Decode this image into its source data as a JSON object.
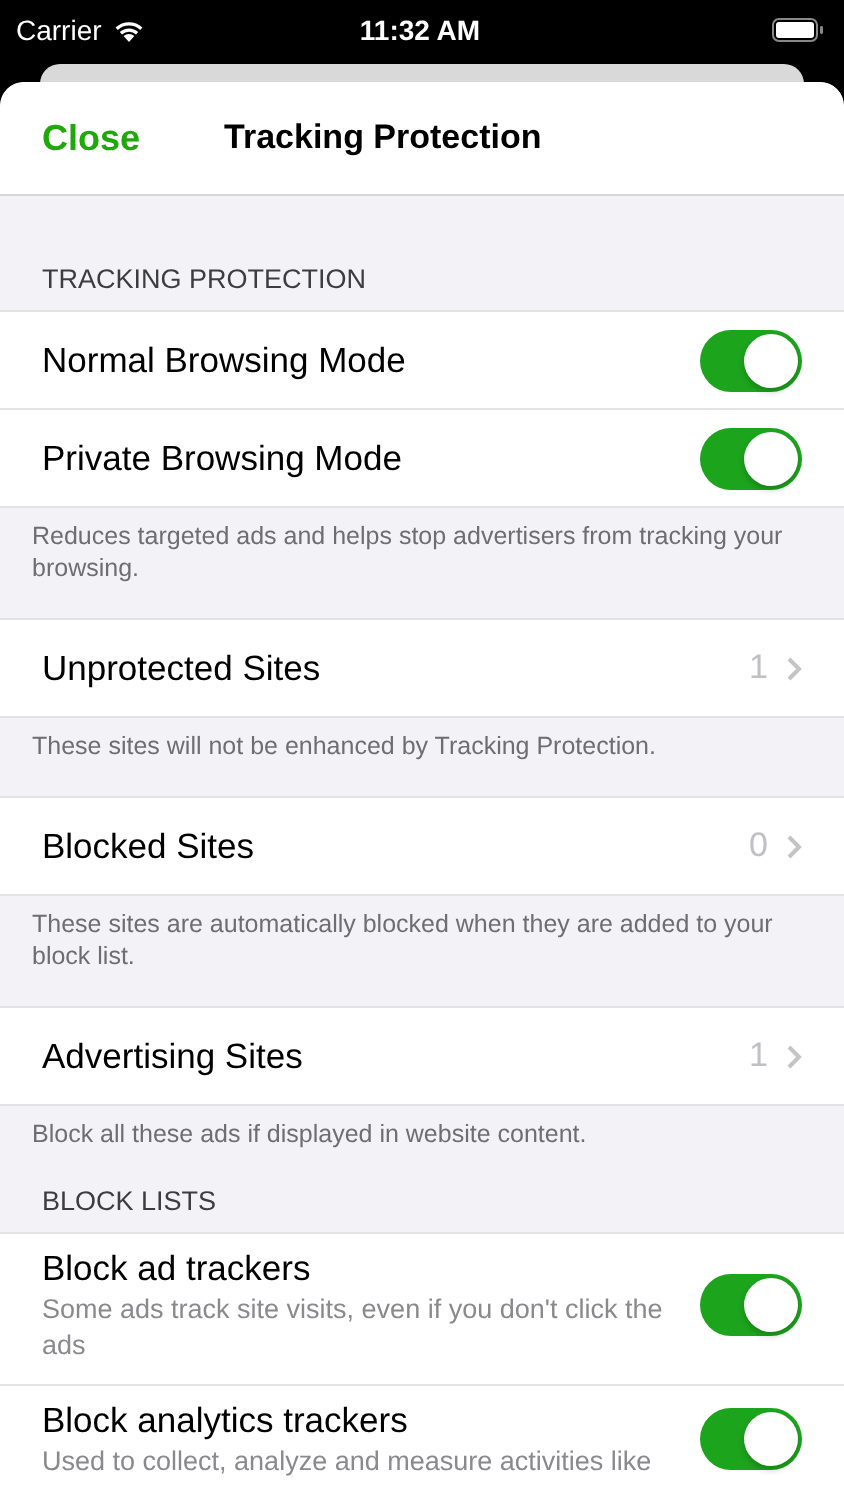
{
  "status_bar": {
    "carrier": "Carrier",
    "time": "11:32 AM"
  },
  "nav": {
    "close": "Close",
    "title": "Tracking Protection"
  },
  "groups": [
    {
      "header": "TRACKING PROTECTION",
      "rows": [
        {
          "kind": "toggle",
          "title": "Normal Browsing Mode",
          "on": true
        },
        {
          "kind": "toggle",
          "title": "Private Browsing Mode",
          "on": true
        }
      ],
      "footer": "Reduces targeted ads and helps stop advertisers from tracking your browsing."
    },
    {
      "rows": [
        {
          "kind": "disclosure",
          "title": "Unprotected Sites",
          "value": "1"
        }
      ],
      "footer": "These sites will not be enhanced by Tracking Protection."
    },
    {
      "rows": [
        {
          "kind": "disclosure",
          "title": "Blocked Sites",
          "value": "0"
        }
      ],
      "footer": "These sites are automatically blocked when they are added to your block list."
    },
    {
      "rows": [
        {
          "kind": "disclosure",
          "title": "Advertising Sites",
          "value": "1"
        }
      ],
      "footer": "Block all these ads if displayed in website content."
    },
    {
      "header": "BLOCK LISTS",
      "rows": [
        {
          "kind": "toggle",
          "title": "Block ad trackers",
          "subtitle": "Some ads track site visits, even if you don't click the ads",
          "on": true
        },
        {
          "kind": "toggle",
          "title": "Block analytics trackers",
          "subtitle": "Used to collect, analyze and measure activities like",
          "on": true
        }
      ]
    }
  ]
}
